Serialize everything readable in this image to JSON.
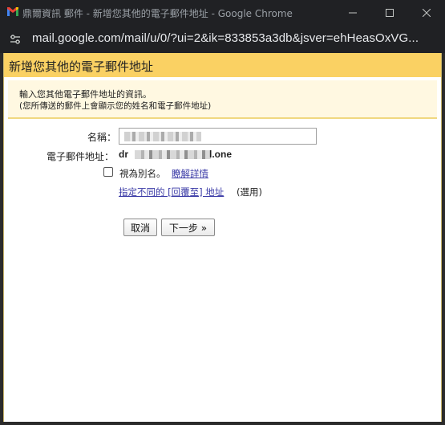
{
  "window": {
    "title": "鼎爾資訊 郵件 - 新增您其他的電子郵件地址 - Google Chrome",
    "url": "mail.google.com/mail/u/0/?ui=2&ik=833853a3db&jsver=ehHeasOxVG..."
  },
  "icons": {
    "app": "gmail-icon",
    "site_info": "tune-icon",
    "minimize": "minimize-icon",
    "maximize": "maximize-icon",
    "close": "close-icon"
  },
  "dialog": {
    "title": "新增您其他的電子郵件地址",
    "description_line1": "輸入您其他電子郵件地址的資訊。",
    "description_line2": "(您所傳送的郵件上會顯示您的姓名和電子郵件地址)",
    "name_label": "名稱：",
    "name_value": "",
    "email_label": "電子郵件地址：",
    "email_prefix": "dr",
    "email_suffix": "l.one",
    "alias_label": "視為別名。",
    "alias_link": "瞭解詳情",
    "reply_link": "指定不同的 [回覆至] 地址",
    "reply_optional": "(選用)",
    "cancel_button": "取消",
    "next_button": "下一步 »"
  },
  "colors": {
    "header_bg": "#fad163",
    "link": "#3a3aa6",
    "chrome_bg": "#202124"
  }
}
